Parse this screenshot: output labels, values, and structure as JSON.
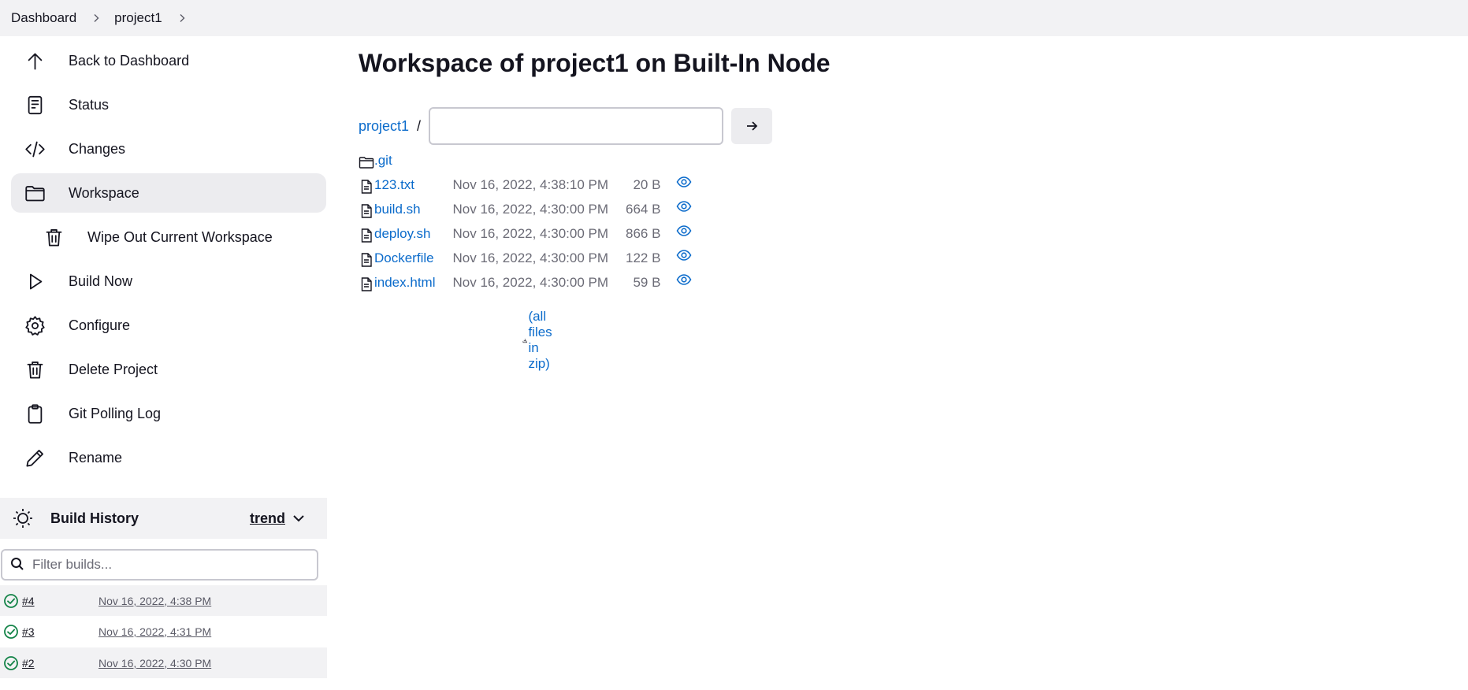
{
  "breadcrumb": {
    "items": [
      "Dashboard",
      "project1"
    ]
  },
  "sidebar": {
    "tasks": [
      {
        "label": "Back to Dashboard",
        "icon": "arrow-up-icon"
      },
      {
        "label": "Status",
        "icon": "document-icon"
      },
      {
        "label": "Changes",
        "icon": "code-icon"
      },
      {
        "label": "Workspace",
        "icon": "folder-icon",
        "active": true
      },
      {
        "label": "Wipe Out Current Workspace",
        "icon": "trash-icon",
        "sub": true
      },
      {
        "label": "Build Now",
        "icon": "play-icon"
      },
      {
        "label": "Configure",
        "icon": "gear-icon"
      },
      {
        "label": "Delete Project",
        "icon": "trash-icon"
      },
      {
        "label": "Git Polling Log",
        "icon": "clipboard-icon"
      },
      {
        "label": "Rename",
        "icon": "pencil-icon"
      }
    ]
  },
  "build_history": {
    "title": "Build History",
    "trend_label": "trend",
    "filter_placeholder": "Filter builds...",
    "builds": [
      {
        "number": "#4",
        "date": "Nov 16, 2022, 4:38 PM",
        "status": "success"
      },
      {
        "number": "#3",
        "date": "Nov 16, 2022, 4:31 PM",
        "status": "success"
      },
      {
        "number": "#2",
        "date": "Nov 16, 2022, 4:30 PM",
        "status": "success"
      }
    ]
  },
  "main": {
    "title": "Workspace of project1 on Built-In Node",
    "path_root": "project1",
    "path_separator": "/",
    "path_input_value": "",
    "files": [
      {
        "name": ".git",
        "type": "folder",
        "date": "",
        "size": ""
      },
      {
        "name": "123.txt",
        "type": "file",
        "date": "Nov 16, 2022, 4:38:10 PM",
        "size": "20 B"
      },
      {
        "name": "build.sh",
        "type": "file",
        "date": "Nov 16, 2022, 4:30:00 PM",
        "size": "664 B"
      },
      {
        "name": "deploy.sh",
        "type": "file",
        "date": "Nov 16, 2022, 4:30:00 PM",
        "size": "866 B"
      },
      {
        "name": "Dockerfile",
        "type": "file",
        "date": "Nov 16, 2022, 4:30:00 PM",
        "size": "122 B"
      },
      {
        "name": "index.html",
        "type": "file",
        "date": "Nov 16, 2022, 4:30:00 PM",
        "size": "59 B"
      }
    ],
    "zip_label": "(all files in zip)"
  },
  "colors": {
    "link": "#0b6bcb",
    "success": "#138347",
    "panel_bg": "#f2f2f4"
  }
}
